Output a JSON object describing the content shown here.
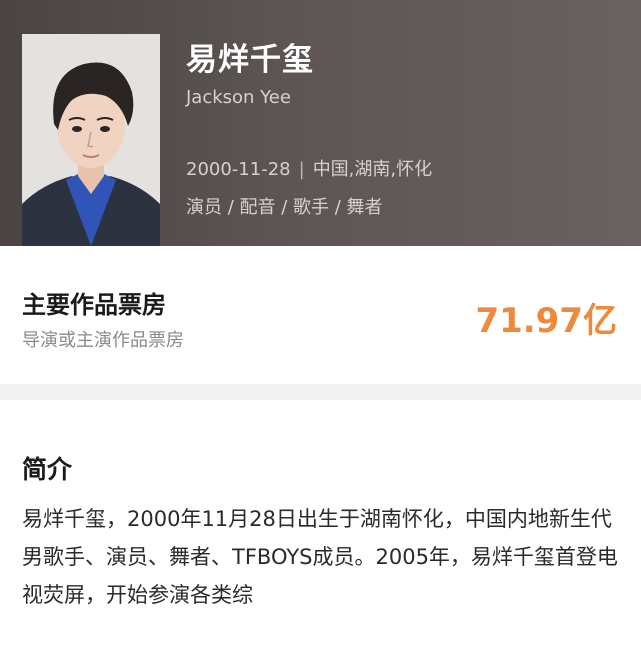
{
  "header": {
    "name": "易烊千玺",
    "english_name": "Jackson Yee",
    "birth_date": "2000-11-28",
    "separator": "|",
    "birthplace": "中国,湖南,怀化",
    "roles": "演员 / 配音 / 歌手 / 舞者"
  },
  "box_office": {
    "title": "主要作品票房",
    "subtitle": "导演或主演作品票房",
    "value": "71.97亿"
  },
  "intro": {
    "title": "简介",
    "text": "易烊千玺，2000年11月28日出生于湖南怀化，中国内地新生代男歌手、演员、舞者、TFBOYS成员。2005年，易烊千玺首登电视荧屏，开始参演各类综"
  },
  "colors": {
    "header_bg": "#5a5352",
    "accent_orange": "#ef8a3c",
    "divider_bg": "#f3f3f3"
  }
}
